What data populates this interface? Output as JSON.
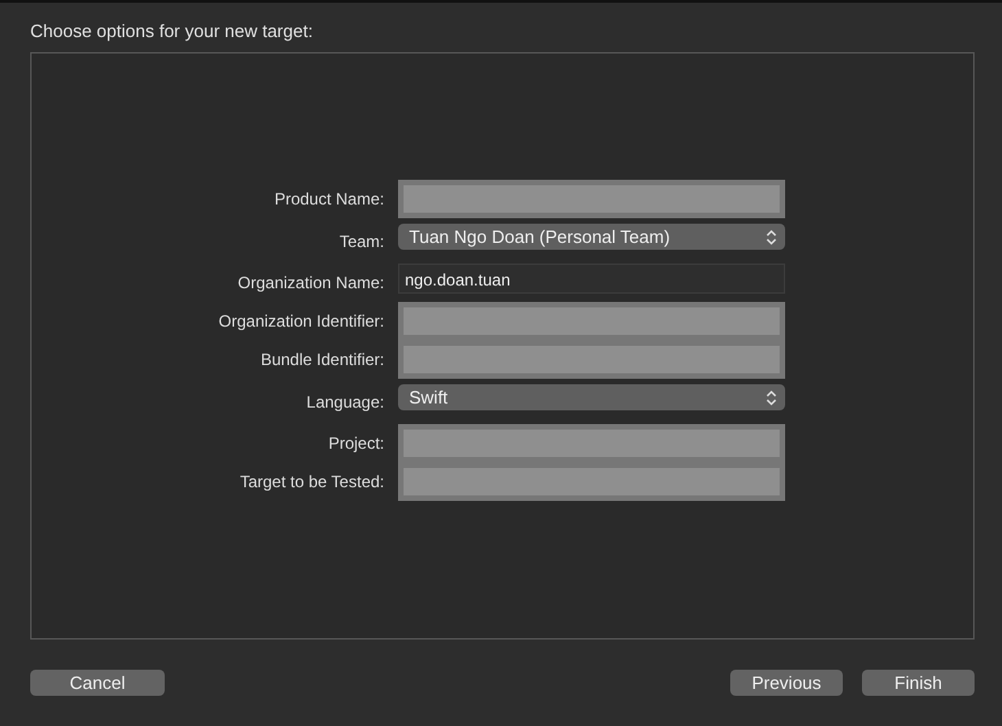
{
  "window": {
    "title": "Choose options for your new target:"
  },
  "fields": [
    {
      "label": "Product Name:",
      "kind": "blank"
    },
    {
      "label": "Team:",
      "kind": "select",
      "value": "Tuan Ngo Doan (Personal Team)"
    },
    {
      "label": "Organization Name:",
      "kind": "text",
      "value": "ngo.doan.tuan"
    },
    {
      "label": "Organization Identifier:",
      "kind": "blank"
    },
    {
      "label": "Bundle Identifier:",
      "kind": "blank"
    },
    {
      "label": "Language:",
      "kind": "select",
      "value": "Swift"
    },
    {
      "label": "Project:",
      "kind": "blank"
    },
    {
      "label": "Target to be Tested:",
      "kind": "blank"
    }
  ],
  "buttons": {
    "left": [
      "Cancel"
    ],
    "right": [
      "Previous",
      "Finish"
    ]
  }
}
